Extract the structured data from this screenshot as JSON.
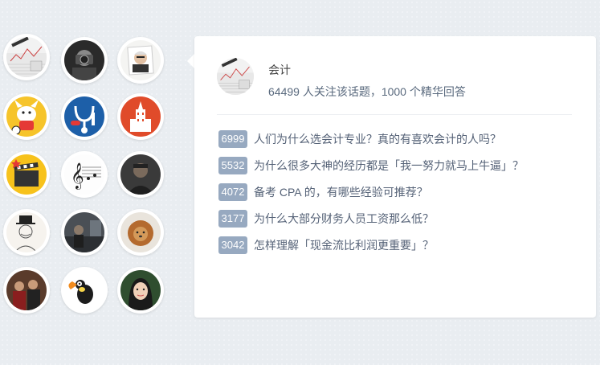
{
  "topics": [
    {
      "name": "topic-accounting-avatar"
    },
    {
      "name": "topic-photographer-avatar"
    },
    {
      "name": "topic-investor-avatar"
    },
    {
      "name": "topic-cartoon-dog-avatar"
    },
    {
      "name": "topic-medicine-avatar"
    },
    {
      "name": "topic-building-avatar"
    },
    {
      "name": "topic-film-clapper-avatar"
    },
    {
      "name": "topic-music-avatar"
    },
    {
      "name": "topic-person-dark-avatar"
    },
    {
      "name": "topic-sketch-avatar"
    },
    {
      "name": "topic-street-photo-avatar"
    },
    {
      "name": "topic-lion-avatar"
    },
    {
      "name": "topic-group-photo-avatar"
    },
    {
      "name": "topic-toucan-avatar"
    },
    {
      "name": "topic-woman-avatar"
    }
  ],
  "card": {
    "title": "会计",
    "stats": "64499 人关注该话题，1000 个精华回答",
    "questions": [
      {
        "count": "6999",
        "text": "人们为什么选会计专业？真的有喜欢会计的人吗？"
      },
      {
        "count": "5532",
        "text": "为什么很多大神的经历都是「我一努力就马上牛逼」？"
      },
      {
        "count": "4072",
        "text": "备考 CPA 的，有哪些经验可推荐？"
      },
      {
        "count": "3177",
        "text": "为什么大部分财务人员工资那么低？"
      },
      {
        "count": "3042",
        "text": "怎样理解「现金流比利润更重要」？"
      }
    ]
  }
}
